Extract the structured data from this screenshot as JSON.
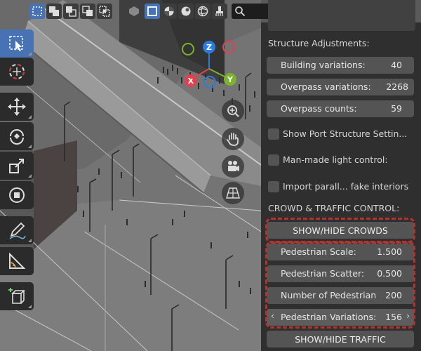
{
  "colors": {
    "accent": "#4772b3",
    "panel_bg": "#2f2f2f",
    "field_bg": "#545454",
    "highlight_ring": "#b5322f",
    "axis_x": "#e0414e",
    "axis_y": "#7cb32e",
    "axis_z": "#2c7ce0"
  },
  "header": {
    "search": {
      "value": "",
      "placeholder": ""
    },
    "icons": [
      "select-box-new-icon",
      "select-extend-icon",
      "select-subtract-icon",
      "select-invert-icon",
      "select-intersect-icon",
      "shading-mode-icon",
      "solid-shading-icon",
      "material-shading-icon",
      "rendered-shading-icon",
      "brush-icon",
      "search-icon",
      "filter-icon"
    ]
  },
  "toolbar": {
    "tools": [
      "select-box",
      "cursor",
      "move",
      "rotate",
      "scale",
      "transform",
      "annotate",
      "measure",
      "add-cube"
    ]
  },
  "gizmo": {
    "z": "Z",
    "x": "X",
    "y": "Y"
  },
  "panel": {
    "section1_title": "Structure Adjustments:",
    "building_variations": {
      "label": "Building variations:",
      "value": "40"
    },
    "overpass_variations": {
      "label": "Overpass variations:",
      "value": "2268"
    },
    "overpass_counts": {
      "label": "Overpass counts:",
      "value": "59"
    },
    "check_port": "Show Port Structure Settin...",
    "check_light": "Man-made light control:",
    "check_interiors": "Import parall... fake interiors",
    "section2_title": "CROWD & TRAFFIC CONTROL:",
    "show_hide_crowds": "SHOW/HIDE CROWDS",
    "pedestrian_scale": {
      "label": "Pedestrian Scale:",
      "value": "1.500"
    },
    "pedestrian_scatter": {
      "label": "Pedestrian Scatter:",
      "value": "0.500"
    },
    "number_pedestrian": {
      "label": "Number of Pedestrian",
      "value": "200"
    },
    "pedestrian_variations": {
      "label": "Pedestrian Variations:",
      "value": "156",
      "left_arrow": "‹",
      "right_arrow": "›"
    },
    "show_hide_traffic": "SHOW/HIDE TRAFFIC"
  }
}
